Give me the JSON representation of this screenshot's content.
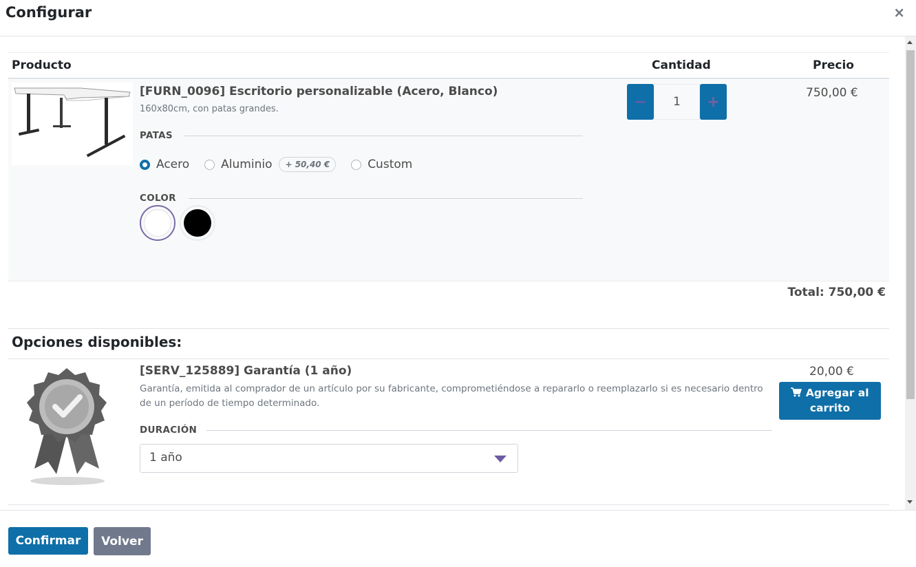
{
  "dialog": {
    "title": "Configurar",
    "close_symbol": "×"
  },
  "table_header": {
    "product": "Producto",
    "quantity": "Cantidad",
    "price": "Precio"
  },
  "product": {
    "name": "[FURN_0096] Escritorio personalizable (Acero, Blanco)",
    "description": "160x80cm, con patas grandes.",
    "legs_label": "PATAS",
    "legs_options": [
      {
        "label": "Acero",
        "checked": true
      },
      {
        "label": "Aluminio",
        "checked": false,
        "extra": "+ 50,40 €"
      },
      {
        "label": "Custom",
        "checked": false
      }
    ],
    "color_label": "COLOR",
    "colors": [
      {
        "name": "Blanco",
        "hex": "#ffffff",
        "selected": true
      },
      {
        "name": "Negro",
        "hex": "#000000",
        "selected": false
      }
    ],
    "quantity": "1",
    "minus_symbol": "−",
    "plus_symbol": "+",
    "price": "750,00 €"
  },
  "total": "Total: 750,00 €",
  "optional": {
    "title": "Opciones disponibles:",
    "item": {
      "name": "[SERV_125889] Garantía (1 año)",
      "description": "Garantía, emitida al comprador de un artículo por su fabricante, comprometiéndose a repararlo o reemplazarlo si es necesario dentro de un período de tiempo determinado.",
      "duration_label": "DURACIÓN",
      "duration_value": "1 año",
      "price": "20,00 €",
      "add_to_cart_line1": "Agregar al",
      "add_to_cart_line2": "carrito"
    }
  },
  "footer": {
    "confirm": "Confirmar",
    "back": "Volver"
  },
  "colors": {
    "primary": "#0f6fa8",
    "secondary": "#71798d",
    "accent": "#6d5ba3"
  }
}
